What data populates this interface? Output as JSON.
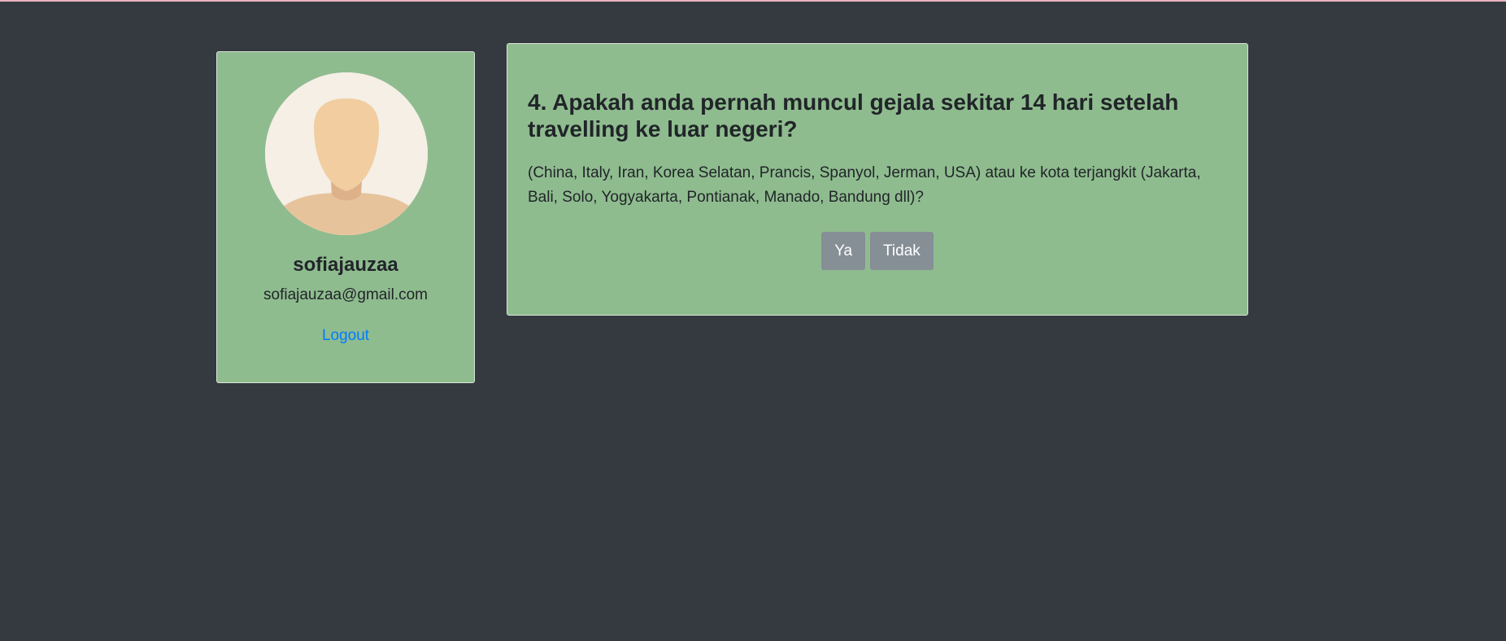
{
  "profile": {
    "username": "sofiajauzaa",
    "email": "sofiajauzaa@gmail.com",
    "logout_label": "Logout",
    "avatar_icon": "default-user-avatar"
  },
  "question": {
    "title": "4. Apakah anda pernah muncul gejala sekitar 14 hari setelah travelling ke luar negeri?",
    "description": "(China, Italy, Iran, Korea Selatan, Prancis, Spanyol, Jerman, USA) atau ke kota terjangkit (Jakarta, Bali, Solo, Yogyakarta, Pontianak, Manado, Bandung dll)?",
    "yes_label": "Ya",
    "no_label": "Tidak"
  },
  "colors": {
    "background": "#343a40",
    "card": "#8fbc8f",
    "button": "#868e96",
    "link": "#007bff"
  }
}
